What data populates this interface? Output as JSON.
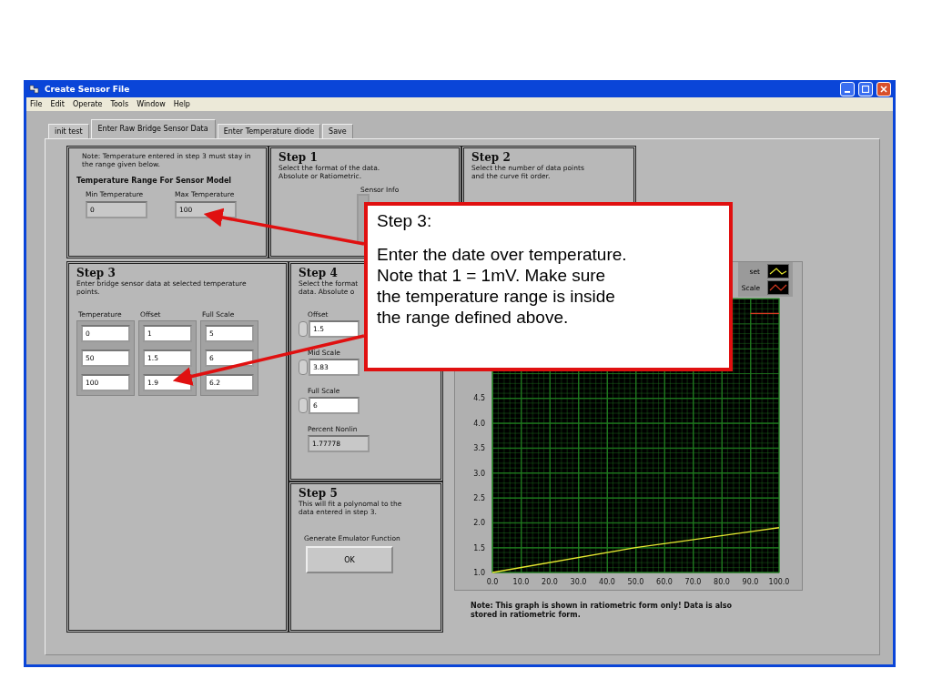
{
  "window": {
    "title": "Create Sensor File"
  },
  "menu": [
    "File",
    "Edit",
    "Operate",
    "Tools",
    "Window",
    "Help"
  ],
  "tabs": [
    {
      "label": "init test",
      "selected": false
    },
    {
      "label": "Enter Raw Bridge Sensor Data",
      "selected": true
    },
    {
      "label": "Enter Temperature diode",
      "selected": false
    },
    {
      "label": "Save",
      "selected": false
    }
  ],
  "note_panel": {
    "note": "Note:  Temperature entered in step 3 must stay in the range given below.",
    "heading": "Temperature Range For Sensor Model",
    "fields": [
      {
        "label": "Min Temperature",
        "value": "0"
      },
      {
        "label": "Max Temperature",
        "value": "100"
      }
    ]
  },
  "step1": {
    "title": "Step 1",
    "description": "Select the format of the data. Absolute or Ratiometric.",
    "control_label": "Sensor Info"
  },
  "step2": {
    "title": "Step 2",
    "description": "Select the number of data points and the curve fit order."
  },
  "step3": {
    "title": "Step 3",
    "description": "Enter bridge sensor data at selected temperature points.",
    "columns": [
      {
        "header": "Temperature",
        "values": [
          "0",
          "50",
          "100"
        ]
      },
      {
        "header": "Offset",
        "values": [
          "1",
          "1.5",
          "1.9"
        ]
      },
      {
        "header": "Full Scale",
        "values": [
          "5",
          "6",
          "6.2"
        ]
      }
    ]
  },
  "step4": {
    "title": "Step 4",
    "description_lines": [
      "Select the format",
      "data.  Absolute o"
    ],
    "fields": [
      {
        "label": "Offset",
        "value": "1.5",
        "kind": "numeric"
      },
      {
        "label": "Mid Scale",
        "value": "3.83",
        "kind": "numeric"
      },
      {
        "label": "Full Scale",
        "value": "6",
        "kind": "numeric"
      },
      {
        "label": "Percent Nonlin",
        "value": "1.77778",
        "kind": "indicator"
      }
    ]
  },
  "step5": {
    "title": "Step 5",
    "description": "This will fit a polynomal to the data entered in step 3.",
    "button_label": "Generate Emulator Function",
    "button": "OK"
  },
  "graph": {
    "chart_data": {
      "type": "line",
      "x": [
        0,
        50,
        90,
        100
      ],
      "grid": true,
      "series": [
        {
          "name": "set",
          "color": "#e8e830",
          "values": [
            1,
            1.5,
            1.82,
            1.9
          ]
        },
        {
          "name": "Scale",
          "color": "#d83a20",
          "values": [
            null,
            null,
            6.2,
            6.2
          ]
        }
      ],
      "xlim": [
        0,
        100
      ],
      "ylim": [
        1,
        6.5
      ],
      "xticks": [
        {
          "value": 0,
          "label": "0.0"
        },
        {
          "value": 10,
          "label": "10.0"
        },
        {
          "value": 20,
          "label": "20.0"
        },
        {
          "value": 30,
          "label": "30.0"
        },
        {
          "value": 40,
          "label": "40.0"
        },
        {
          "value": 50,
          "label": "50.0"
        },
        {
          "value": 60,
          "label": "60.0"
        },
        {
          "value": 70,
          "label": "70.0"
        },
        {
          "value": 80,
          "label": "80.0"
        },
        {
          "value": 90,
          "label": "90.0"
        },
        {
          "value": 100,
          "label": "100.0"
        }
      ],
      "yticks": [
        {
          "value": 1,
          "label": "1.0"
        },
        {
          "value": 1.5,
          "label": "1.5"
        },
        {
          "value": 2,
          "label": "2.0"
        },
        {
          "value": 2.5,
          "label": "2.5"
        },
        {
          "value": 3,
          "label": "3.0"
        },
        {
          "value": 3.5,
          "label": "3.5"
        },
        {
          "value": 4,
          "label": "4.0"
        },
        {
          "value": 4.5,
          "label": "4.5"
        }
      ]
    },
    "note": "Note:  This graph is shown in ratiometric form only!  Data is also stored in ratiometric form."
  },
  "callout": {
    "title": "Step 3:",
    "text": "Enter the date over temperature.\nNote that 1 = 1mV.  Make sure\nthe temperature range is inside\nthe range defined above."
  }
}
